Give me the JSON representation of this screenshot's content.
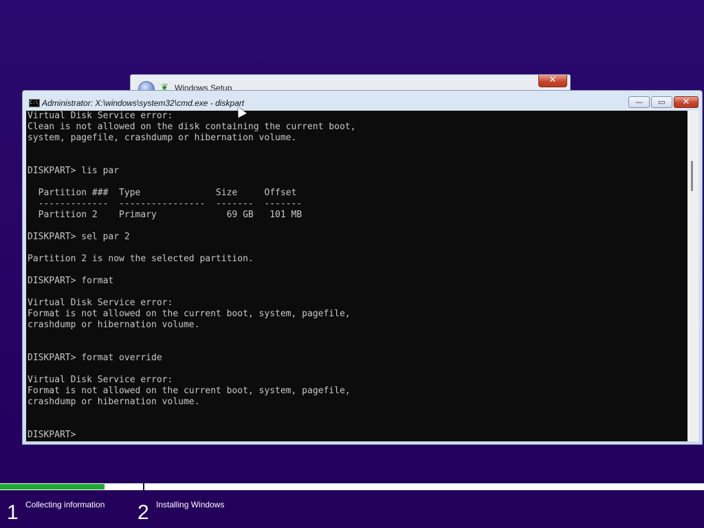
{
  "setup_window": {
    "title": "Windows Setup",
    "leaf_glyph": "❦",
    "close_glyph": "✕"
  },
  "cmd_window": {
    "title": "Administrator: X:\\windows\\system32\\cmd.exe - diskpart",
    "icon": "cmd-icon",
    "icon_text": "C:\\",
    "minimize_glyph": "—",
    "maximize_glyph": "▭",
    "close_glyph": "✕"
  },
  "console": {
    "text": "Virtual Disk Service error:\nClean is not allowed on the disk containing the current boot,\nsystem, pagefile, crashdump or hibernation volume.\n\n\nDISKPART> lis par\n\n  Partition ###  Type              Size     Offset\n  -------------  ----------------  -------  -------\n  Partition 2    Primary             69 GB   101 MB\n\nDISKPART> sel par 2\n\nPartition 2 is now the selected partition.\n\nDISKPART> format\n\nVirtual Disk Service error:\nFormat is not allowed on the current boot, system, pagefile,\ncrashdump or hibernation volume.\n\n\nDISKPART> format override\n\nVirtual Disk Service error:\nFormat is not allowed on the current boot, system, pagefile,\ncrashdump or hibernation volume.\n\n\nDISKPART>"
  },
  "progress": {
    "steps": [
      {
        "number": "1",
        "label": "Collecting information"
      },
      {
        "number": "2",
        "label": "Installing Windows"
      }
    ],
    "step1_fill_fraction": 0.73,
    "colors": {
      "fill": "#1fa834",
      "track": "#ffffff",
      "background": "#23005a"
    }
  }
}
